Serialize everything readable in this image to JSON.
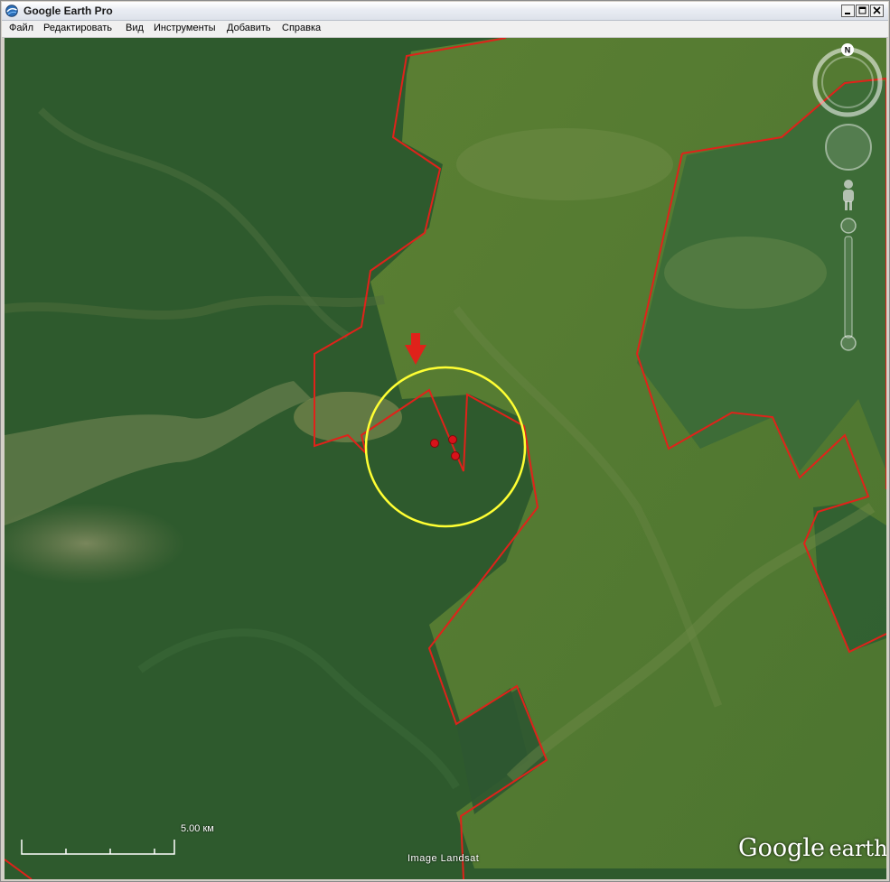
{
  "window": {
    "title": "Google Earth Pro"
  },
  "menu": {
    "items": [
      "Файл",
      "Редактировать",
      "Вид",
      "Инструменты",
      "Добавить",
      "Справка"
    ]
  },
  "map": {
    "imagery_credit": "Image Landsat",
    "scale_label": "5.00 км",
    "logo_google": "Google",
    "logo_earth": "earth",
    "compass_label": "N",
    "colors": {
      "boundary": "#e0221a",
      "circle": "#ffff33",
      "marker": "#d8121a",
      "arrow": "#e0221a",
      "forest_dark": "#2d5a2e",
      "forest_light": "#53772f"
    }
  },
  "icons": {
    "app": "google-earth-globe-icon",
    "minimize": "minimize-icon",
    "maximize": "maximize-icon",
    "close": "close-icon",
    "compass": "compass-icon",
    "look": "look-joystick-icon",
    "street_view": "pegman-icon",
    "zoom": "zoom-slider-icon"
  }
}
